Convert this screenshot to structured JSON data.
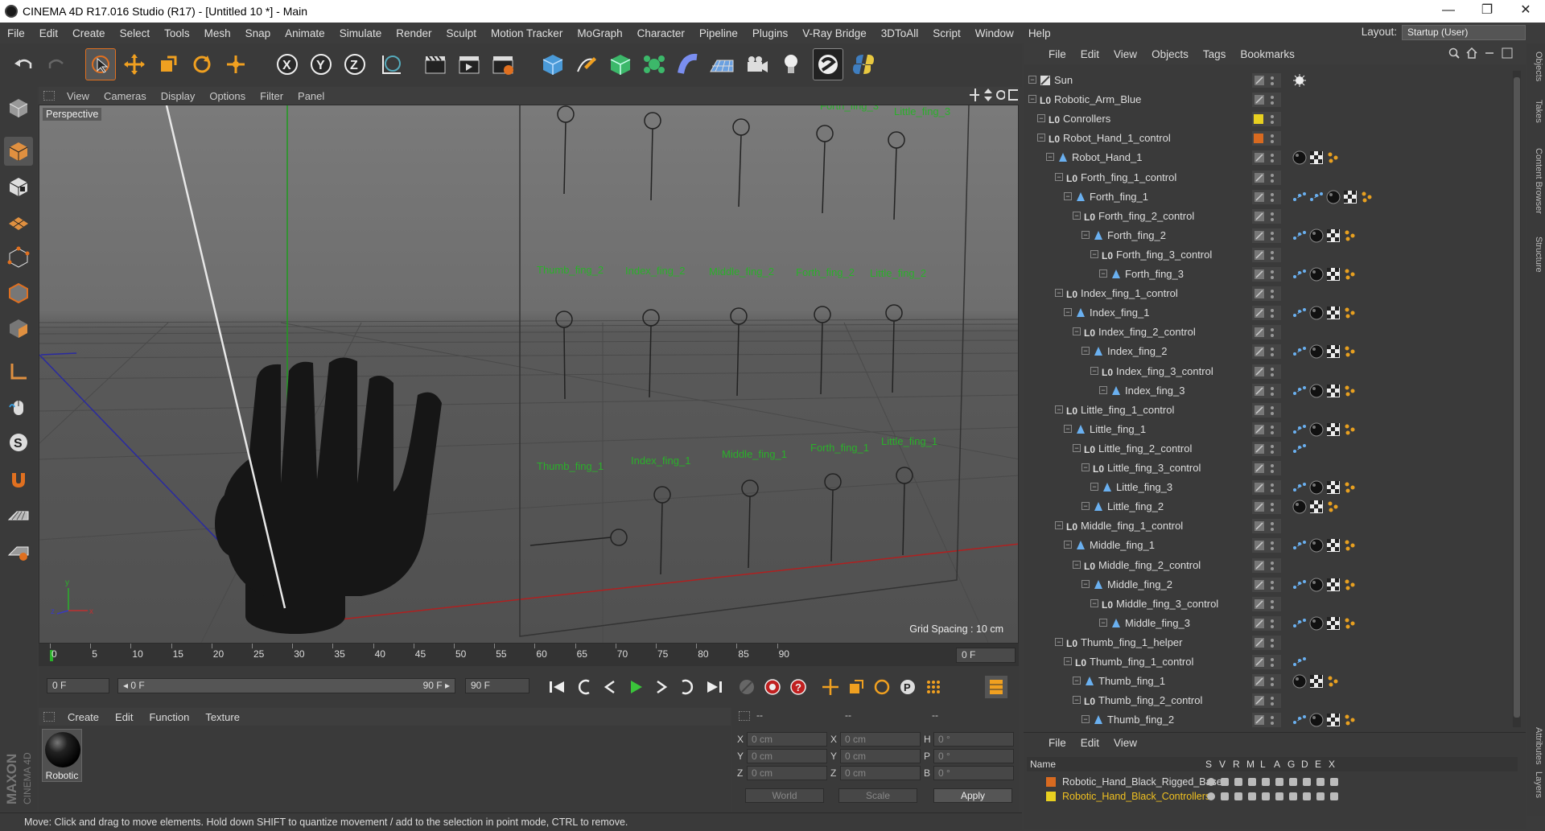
{
  "window": {
    "title": "CINEMA 4D R17.016 Studio (R17) - [Untitled 10 *] - Main",
    "minimize": "—",
    "maximize": "❐",
    "close": "✕"
  },
  "menubar": {
    "items": [
      "File",
      "Edit",
      "Create",
      "Select",
      "Tools",
      "Mesh",
      "Snap",
      "Animate",
      "Simulate",
      "Render",
      "Sculpt",
      "Motion Tracker",
      "MoGraph",
      "Character",
      "Pipeline",
      "Plugins",
      "V-Ray Bridge",
      "3DToAll",
      "Script",
      "Window",
      "Help"
    ],
    "layout_label": "Layout:",
    "layout_value": "Startup (User)"
  },
  "viewport": {
    "menu": [
      "View",
      "Cameras",
      "Display",
      "Options",
      "Filter",
      "Panel"
    ],
    "camera_label": "Perspective",
    "grid_spacing": "Grid Spacing : 10 cm",
    "labels_row1": [
      "Thumb_fing_2",
      "Index_fing_2",
      "Middle_fing_2",
      "Forth_fing_2",
      "Little_fing_2"
    ],
    "labels_row2": [
      "Thumb_fing_1",
      "Index_fing_1",
      "Middle_fing_1",
      "Forth_fing_1",
      "Little_fing_1"
    ],
    "labels_top": [
      "Forth_fing_3",
      "Little_fing_3"
    ]
  },
  "timeline": {
    "ticks": [
      "0",
      "5",
      "10",
      "15",
      "20",
      "25",
      "30",
      "35",
      "40",
      "45",
      "50",
      "55",
      "60",
      "65",
      "70",
      "75",
      "80",
      "85",
      "90"
    ],
    "current_frame": "0 F",
    "start_frame": "0 F",
    "range_start": "◂ 0 F",
    "range_end": "90 F ▸",
    "end_frame": "90 F",
    "end_frame2": "90 F"
  },
  "material_manager": {
    "menu": [
      "Create",
      "Edit",
      "Function",
      "Texture"
    ],
    "material_name": "Robotic"
  },
  "coordinates": {
    "header": [
      "--",
      "--",
      "--"
    ],
    "rows": [
      {
        "a": "X",
        "av": "0 cm",
        "b": "X",
        "bv": "0 cm",
        "c": "H",
        "cv": "0 °"
      },
      {
        "a": "Y",
        "av": "0 cm",
        "b": "Y",
        "bv": "0 cm",
        "c": "P",
        "cv": "0 °"
      },
      {
        "a": "Z",
        "av": "0 cm",
        "b": "Z",
        "bv": "0 cm",
        "c": "B",
        "cv": "0 °"
      }
    ],
    "mode1": "World",
    "mode2": "Scale",
    "apply": "Apply"
  },
  "statusbar": {
    "text": "Move: Click and drag to move elements. Hold down SHIFT to quantize movement / add to the selection in point mode, CTRL to remove."
  },
  "object_manager": {
    "menu": [
      "File",
      "Edit",
      "View",
      "Objects",
      "Tags",
      "Bookmarks"
    ],
    "objects": [
      {
        "name": "Sun",
        "indent": 0,
        "type": "light",
        "tags": [
          "sun"
        ]
      },
      {
        "name": "Robotic_Arm_Blue",
        "indent": 0,
        "type": "null",
        "tags": []
      },
      {
        "name": "Conrollers",
        "indent": 1,
        "type": "null",
        "swatch": "#e8d020",
        "tags": []
      },
      {
        "name": "Robot_Hand_1_control",
        "indent": 1,
        "type": "null",
        "swatch": "#d86a20",
        "tags": []
      },
      {
        "name": "Robot_Hand_1",
        "indent": 2,
        "type": "joint",
        "tags": [
          "sphere",
          "checker",
          "dots"
        ]
      },
      {
        "name": "Forth_fing_1_control",
        "indent": 3,
        "type": "null",
        "tags": []
      },
      {
        "name": "Forth_fing_1",
        "indent": 4,
        "type": "joint",
        "tags": [
          "ik",
          "ik",
          "sphere",
          "checker",
          "dots"
        ]
      },
      {
        "name": "Forth_fing_2_control",
        "indent": 5,
        "type": "null",
        "tags": []
      },
      {
        "name": "Forth_fing_2",
        "indent": 6,
        "type": "joint",
        "tags": [
          "ik",
          "sphere",
          "checker",
          "dots"
        ]
      },
      {
        "name": "Forth_fing_3_control",
        "indent": 7,
        "type": "null",
        "tags": []
      },
      {
        "name": "Forth_fing_3",
        "indent": 8,
        "type": "joint",
        "tags": [
          "ik",
          "sphere",
          "checker",
          "dots"
        ]
      },
      {
        "name": "Index_fing_1_control",
        "indent": 3,
        "type": "null",
        "tags": []
      },
      {
        "name": "Index_fing_1",
        "indent": 4,
        "type": "joint",
        "tags": [
          "ik",
          "sphere",
          "checker",
          "dots"
        ]
      },
      {
        "name": "Index_fing_2_control",
        "indent": 5,
        "type": "null",
        "tags": []
      },
      {
        "name": "Index_fing_2",
        "indent": 6,
        "type": "joint",
        "tags": [
          "ik",
          "sphere",
          "checker",
          "dots"
        ]
      },
      {
        "name": "Index_fing_3_control",
        "indent": 7,
        "type": "null",
        "tags": []
      },
      {
        "name": "Index_fing_3",
        "indent": 8,
        "type": "joint",
        "tags": [
          "ik",
          "sphere",
          "checker",
          "dots"
        ]
      },
      {
        "name": "Little_fing_1_control",
        "indent": 3,
        "type": "null",
        "tags": []
      },
      {
        "name": "Little_fing_1",
        "indent": 4,
        "type": "joint",
        "tags": [
          "ik",
          "sphere",
          "checker",
          "dots"
        ]
      },
      {
        "name": "Little_fing_2_control",
        "indent": 5,
        "type": "null",
        "tags": [
          "ik"
        ]
      },
      {
        "name": "Little_fing_3_control",
        "indent": 6,
        "type": "null",
        "tags": []
      },
      {
        "name": "Little_fing_3",
        "indent": 7,
        "type": "joint",
        "tags": [
          "ik",
          "sphere",
          "checker",
          "dots"
        ]
      },
      {
        "name": "Little_fing_2",
        "indent": 6,
        "type": "joint",
        "tags": [
          "sphere",
          "checker",
          "dots"
        ]
      },
      {
        "name": "Middle_fing_1_control",
        "indent": 3,
        "type": "null",
        "tags": []
      },
      {
        "name": "Middle_fing_1",
        "indent": 4,
        "type": "joint",
        "tags": [
          "ik",
          "sphere",
          "checker",
          "dots"
        ]
      },
      {
        "name": "Middle_fing_2_control",
        "indent": 5,
        "type": "null",
        "tags": []
      },
      {
        "name": "Middle_fing_2",
        "indent": 6,
        "type": "joint",
        "tags": [
          "ik",
          "sphere",
          "checker",
          "dots"
        ]
      },
      {
        "name": "Middle_fing_3_control",
        "indent": 7,
        "type": "null",
        "tags": []
      },
      {
        "name": "Middle_fing_3",
        "indent": 8,
        "type": "joint",
        "tags": [
          "ik",
          "sphere",
          "checker",
          "dots"
        ]
      },
      {
        "name": "Thumb_fing_1_helper",
        "indent": 3,
        "type": "null",
        "tags": []
      },
      {
        "name": "Thumb_fing_1_control",
        "indent": 4,
        "type": "null",
        "tags": [
          "ik"
        ]
      },
      {
        "name": "Thumb_fing_1",
        "indent": 5,
        "type": "joint",
        "tags": [
          "sphere",
          "checker",
          "dots"
        ]
      },
      {
        "name": "Thumb_fing_2_control",
        "indent": 5,
        "type": "null",
        "tags": []
      },
      {
        "name": "Thumb_fing_2",
        "indent": 6,
        "type": "joint",
        "tags": [
          "ik",
          "sphere",
          "checker",
          "dots"
        ]
      }
    ]
  },
  "layer_manager": {
    "menu": [
      "File",
      "Edit",
      "View"
    ],
    "columns": [
      "Name",
      "S",
      "V",
      "R",
      "M",
      "L",
      "A",
      "G",
      "D",
      "E",
      "X"
    ],
    "layers": [
      {
        "name": "Robotic_Hand_Black_Rigged_Base",
        "color": "#d86a20",
        "text_color": "#dddddd"
      },
      {
        "name": "Robotic_Hand_Black_Controllers",
        "color": "#e8d020",
        "text_color": "#f0c020"
      }
    ]
  },
  "right_tabs": [
    "Objects",
    "Takes",
    "Content Browser",
    "Structure",
    "Attributes",
    "Layers"
  ],
  "brand": "MAXON CINEMA 4D"
}
